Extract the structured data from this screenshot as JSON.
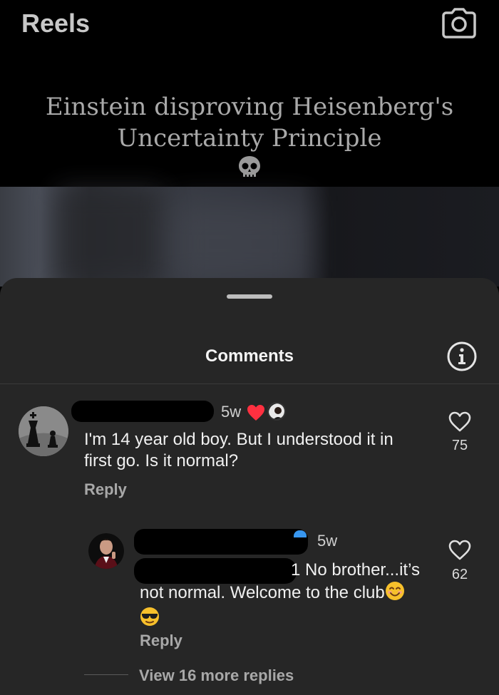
{
  "header": {
    "title": "Reels",
    "camera_icon": "camera-icon"
  },
  "reel": {
    "caption_line1": "Einstein disproving Heisenberg's",
    "caption_line2": "Uncertainty Principle",
    "caption_emoji": "skull"
  },
  "comments_sheet": {
    "title": "Comments",
    "info_icon": "info-icon",
    "comments": [
      {
        "username_redacted": true,
        "time": "5w",
        "liked_by_author": true,
        "text_line1": "I'm 14 year old boy. But I understood it in",
        "text_line2": "first go. Is it normal?",
        "reply_label": "Reply",
        "likes": "75"
      }
    ],
    "reply": {
      "username_redacted": true,
      "time": "5w",
      "text_line1": "1 No brother...it’s",
      "text_line2": "not normal. Welcome to the club",
      "text_emojis": [
        "smiling-face",
        "sunglasses-face"
      ],
      "reply_label": "Reply",
      "likes": "62"
    },
    "view_more_label": "View 16 more replies"
  },
  "colors": {
    "sheet_bg": "#262626",
    "heart_red": "#ff3040",
    "secondary_text": "#a8a8a8"
  }
}
